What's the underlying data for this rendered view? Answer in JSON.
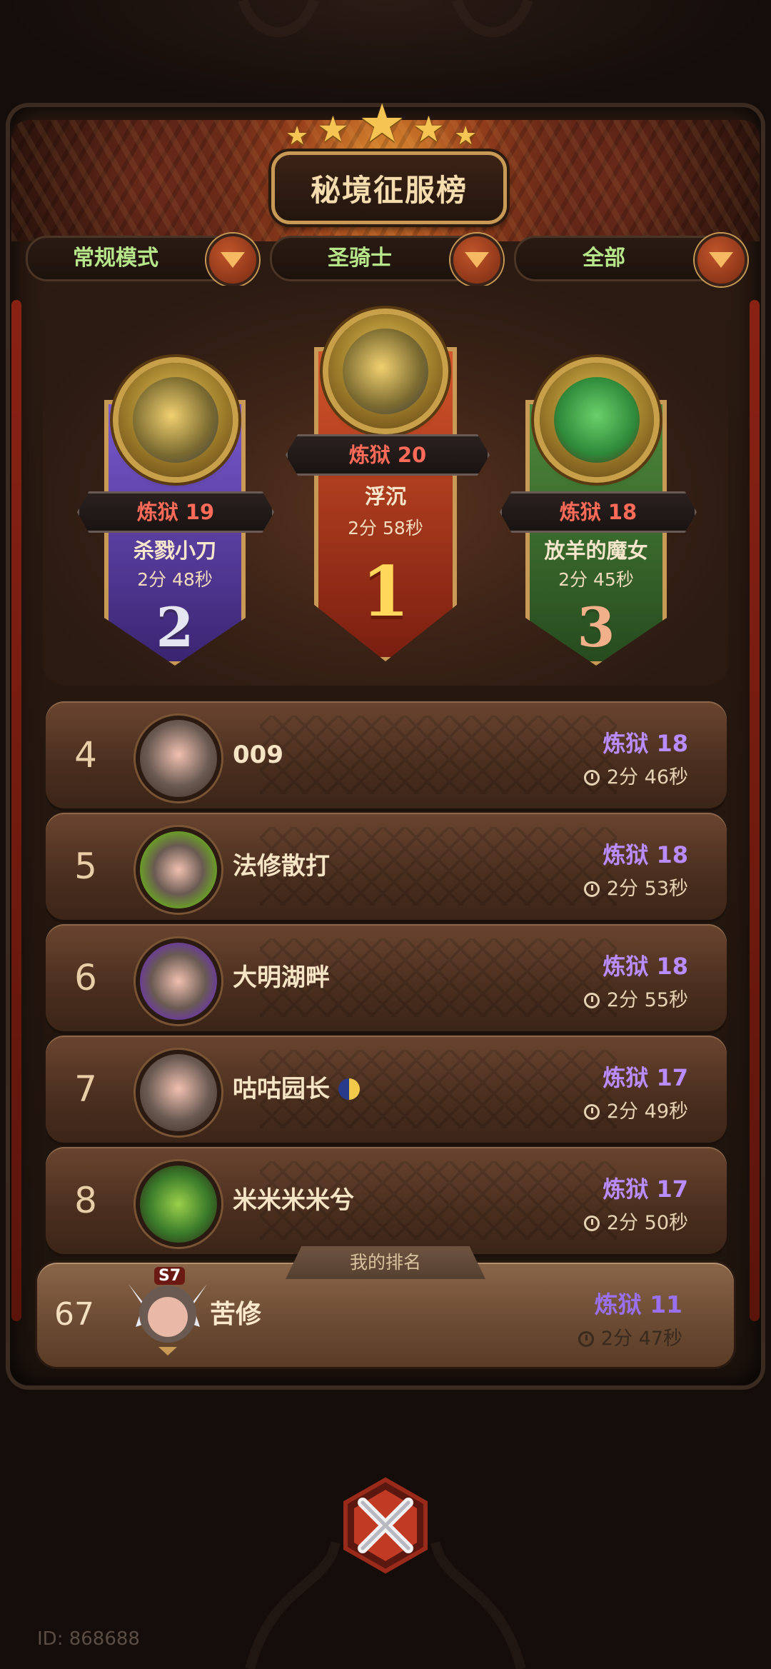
{
  "header": {
    "title": "秘境征服榜"
  },
  "filters": [
    {
      "label": "常规模式"
    },
    {
      "label": "圣骑士"
    },
    {
      "label": "全部"
    }
  ],
  "podium": [
    {
      "rank": "1",
      "tier": "炼狱 20",
      "name": "浮沉",
      "time": "2分 58秒",
      "color": "#b83a1e"
    },
    {
      "rank": "2",
      "tier": "炼狱 19",
      "name": "杀戮小刀",
      "time": "2分 48秒",
      "color": "#5a3a9a"
    },
    {
      "rank": "3",
      "tier": "炼狱 18",
      "name": "放羊的魔女",
      "time": "2分 45秒",
      "color": "#3f6e33"
    }
  ],
  "rows": [
    {
      "rank": "4",
      "name": "009",
      "tier": "炼狱 18",
      "time": "2分 46秒"
    },
    {
      "rank": "5",
      "name": "法修散打",
      "tier": "炼狱 18",
      "time": "2分 53秒"
    },
    {
      "rank": "6",
      "name": "大明湖畔",
      "tier": "炼狱 18",
      "time": "2分 55秒"
    },
    {
      "rank": "7",
      "name": "咕咕园长",
      "tier": "炼狱 17",
      "time": "2分 49秒"
    },
    {
      "rank": "8",
      "name": "米米米米兮",
      "tier": "炼狱 17",
      "time": "2分 50秒"
    }
  ],
  "my_rank": {
    "tab_label": "我的排名",
    "rank": "67",
    "badge": "S7",
    "name": "苦修",
    "tier": "炼狱 11",
    "time": "2分 47秒"
  },
  "footer": {
    "id_text": "ID: 868688"
  },
  "colors": {
    "tier_red": "#ff6b58",
    "tier_purple": "#b98cff",
    "accent_gold": "#c89a55"
  }
}
